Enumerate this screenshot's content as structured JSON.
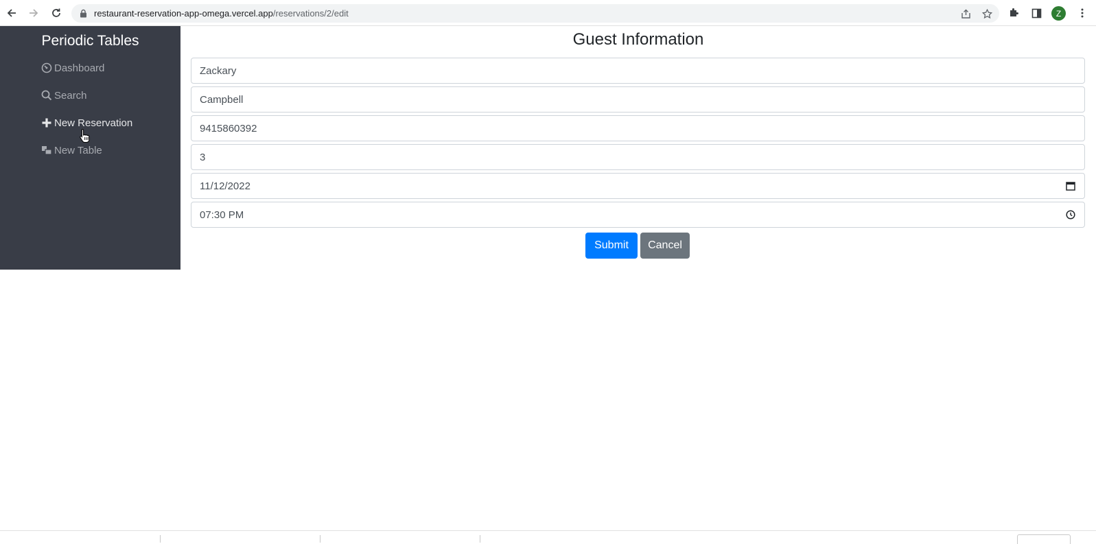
{
  "browser": {
    "url_host": "restaurant-reservation-app-omega.vercel.app",
    "url_path": "/reservations/2/edit",
    "profile_initial": "Z"
  },
  "sidebar": {
    "brand": "Periodic Tables",
    "items": [
      {
        "label": "Dashboard",
        "icon": "dashboard-icon"
      },
      {
        "label": "Search",
        "icon": "search-icon"
      },
      {
        "label": "New Reservation",
        "icon": "plus-icon"
      },
      {
        "label": "New Table",
        "icon": "table-icon"
      }
    ]
  },
  "form": {
    "title": "Guest Information",
    "first_name": "Zackary",
    "last_name": "Campbell",
    "mobile_number": "9415860392",
    "people": "3",
    "reservation_date": "11/12/2022",
    "reservation_time": "07:30 PM",
    "submit_label": "Submit",
    "cancel_label": "Cancel"
  },
  "colors": {
    "sidebar_bg": "#393d47",
    "primary": "#007bff",
    "secondary": "#6c757d"
  }
}
